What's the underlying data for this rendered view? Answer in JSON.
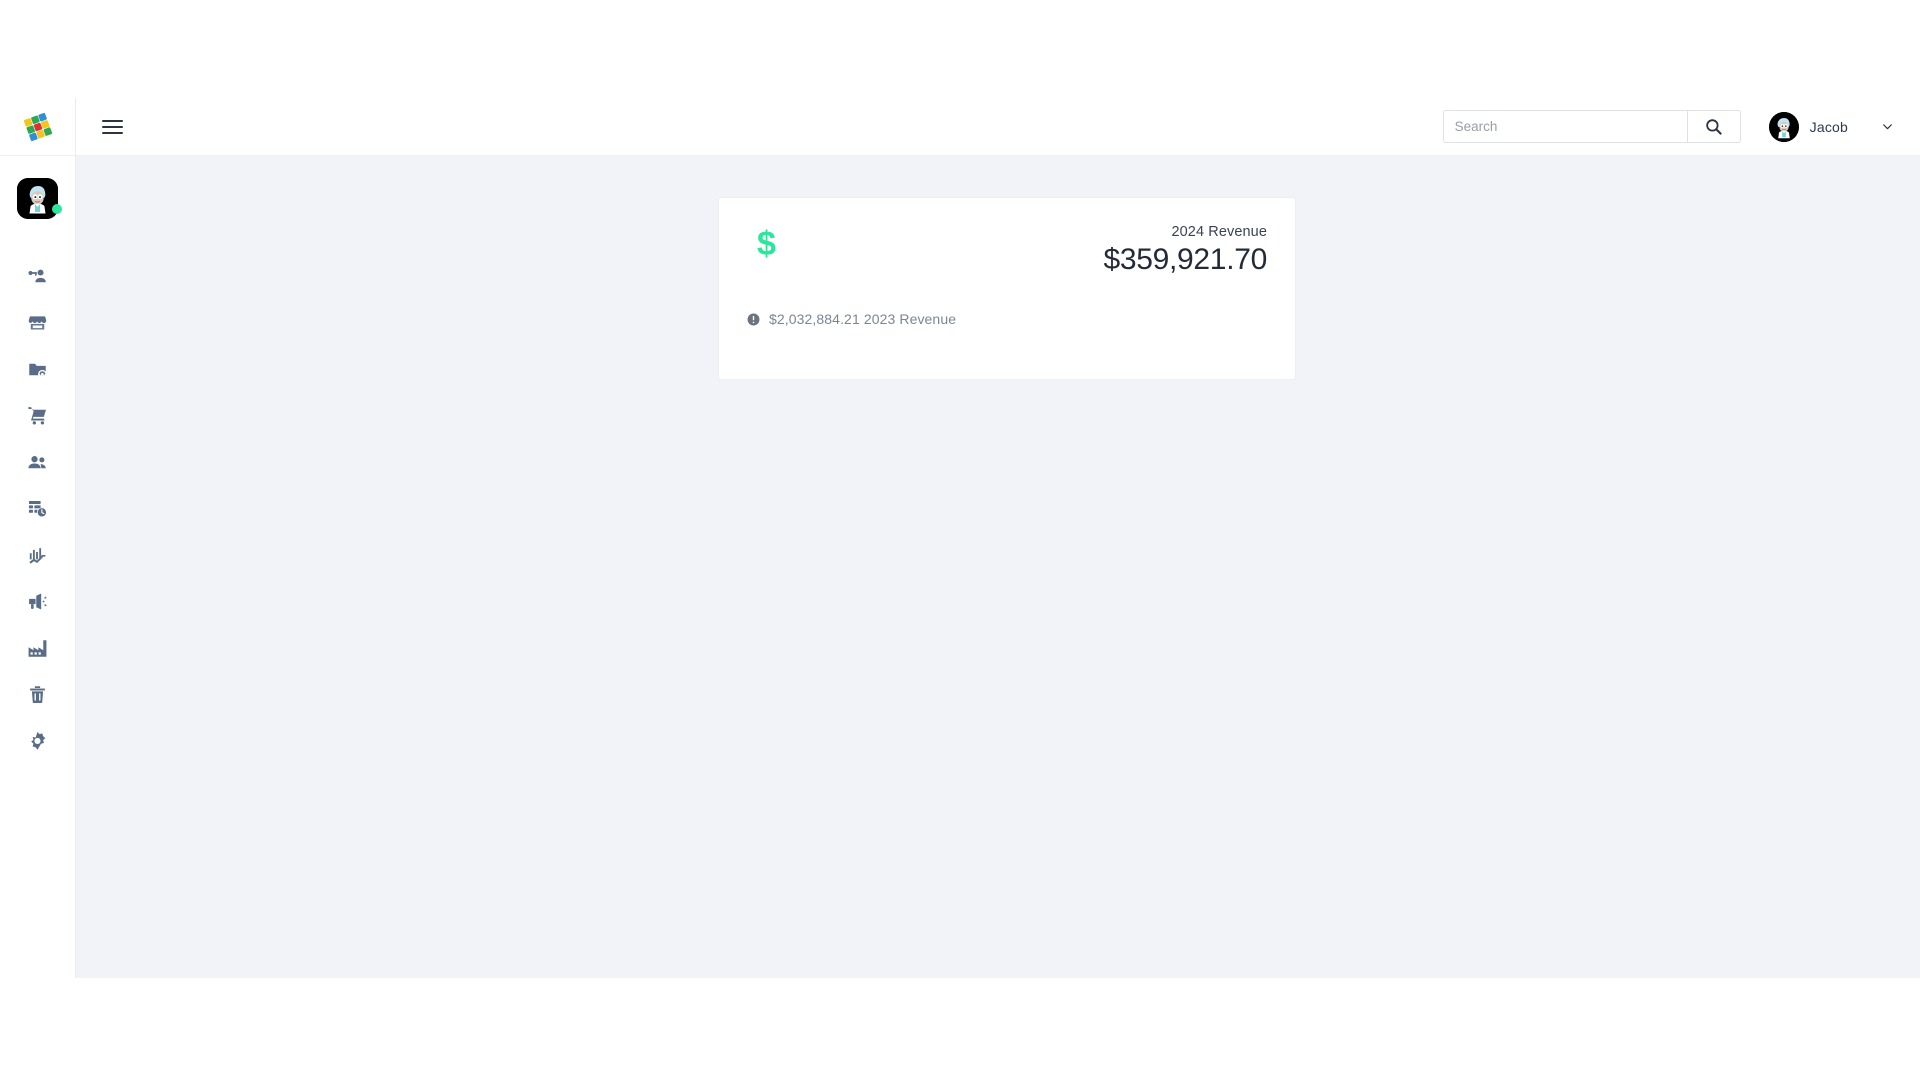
{
  "sidebar": {
    "brand": {
      "icon": "rubiks-cube-logo",
      "alt": "Rubik's cube brand logo"
    },
    "avatar": {
      "icon": "user-avatar",
      "status": "online",
      "status_color": "#2ee59d"
    },
    "items": [
      {
        "icon": "account-key-icon",
        "label": "Accounts"
      },
      {
        "icon": "store-icon",
        "label": "Store"
      },
      {
        "icon": "folder-settings-icon",
        "label": "Folder Settings"
      },
      {
        "icon": "shopping-cart-icon",
        "label": "Orders"
      },
      {
        "icon": "people-icon",
        "label": "Customers"
      },
      {
        "icon": "table-clock-icon",
        "label": "Scheduling"
      },
      {
        "icon": "analytics-chart-icon",
        "label": "Analytics"
      },
      {
        "icon": "megaphone-icon",
        "label": "Marketing"
      },
      {
        "icon": "factory-icon",
        "label": "Manufacturing"
      },
      {
        "icon": "trash-icon",
        "label": "Trash"
      },
      {
        "icon": "gear-icon",
        "label": "Settings"
      }
    ]
  },
  "topbar": {
    "menu_toggle": {
      "icon": "hamburger-menu-icon",
      "label": "Toggle navigation"
    },
    "search": {
      "placeholder": "Search",
      "value": "",
      "button_icon": "search-icon"
    },
    "user": {
      "name": "Jacob",
      "avatar_icon": "user-avatar",
      "caret_icon": "chevron-down-icon"
    }
  },
  "content": {
    "revenue_card": {
      "currency_icon": "dollar-sign-icon",
      "currency_icon_color": "#2ee59d",
      "label": "2024 Revenue",
      "amount": "$359,921.70",
      "footer_icon": "info-icon",
      "footer_text": "$2,032,884.21 2023 Revenue"
    }
  },
  "colors": {
    "content_background": "#f2f3f8",
    "card_background": "#ffffff",
    "accent_green": "#2ee59d",
    "icon_grey": "#5a6c87",
    "text_dark": "#232b39",
    "text_muted": "#7d8595"
  }
}
